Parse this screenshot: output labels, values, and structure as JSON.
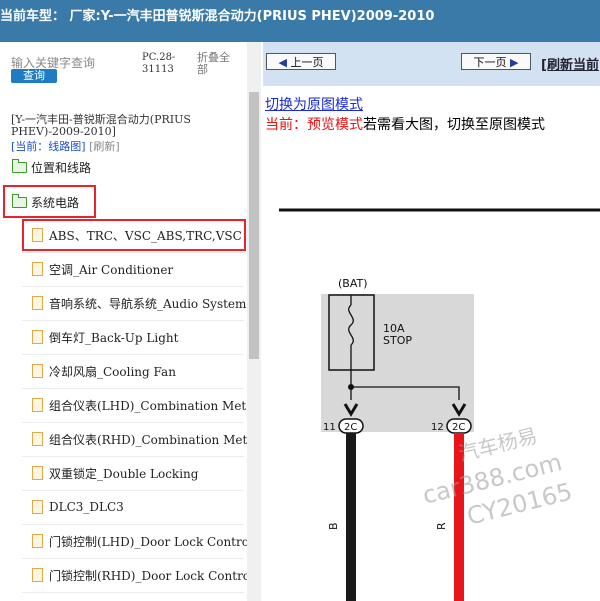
{
  "header": {
    "title": "当前车型：  厂家:Y-一汽丰田普锐斯混合动力(PRIUS PHEV)2009-2010"
  },
  "search": {
    "placeholder": "输入关键字查询",
    "button": "查询"
  },
  "pc_info": "PC.28-31113",
  "collapse_all": "折叠全部",
  "model_text": "[Y-一汽丰田-普锐斯混合动力(PRIUS PHEV)-2009-2010]",
  "current": {
    "label": "[当前：线路图]",
    "refresh": "[刷新]"
  },
  "tree": {
    "folders": [
      "位置和线路",
      "系统电路"
    ],
    "items": [
      "ABS、TRC、VSC_ABS,TRC,VSC",
      "空调_Air Conditioner",
      "音响系统、导航系统_Audio System",
      "倒车灯_Back-Up Light",
      "冷却风扇_Cooling Fan",
      "组合仪表(LHD)_Combination Meter",
      "组合仪表(RHD)_Combination Meter",
      "双重锁定_Double Locking",
      "DLC3_DLC3",
      "门锁控制(LHD)_Door Lock Control",
      "门锁控制(RHD)_Door Lock Control"
    ]
  },
  "nav": {
    "prev": "上一页",
    "next": "下一页",
    "refresh_page": "[刷新当前"
  },
  "mode": {
    "switch_link": "切换为原图模式",
    "current_prefix": "当前：预览模式",
    "current_suffix": "若需看大图，切换至原图模式"
  },
  "diagram": {
    "bat_label": "(BAT)",
    "fuse_amp": "10A",
    "fuse_name": "STOP",
    "pin_left": "11",
    "pin_right": "12",
    "connector_left": "2C",
    "connector_right": "2C",
    "wire_left": "B",
    "wire_right": "R",
    "watermark_1": "汽车杨易",
    "watermark_2": "car388.com",
    "watermark_3": "CY20165"
  },
  "colors": {
    "titlebar": "#3a7aa8",
    "highlight": "#e8232a",
    "wire_red": "#e8161b",
    "wire_black": "#1a1a1a"
  }
}
